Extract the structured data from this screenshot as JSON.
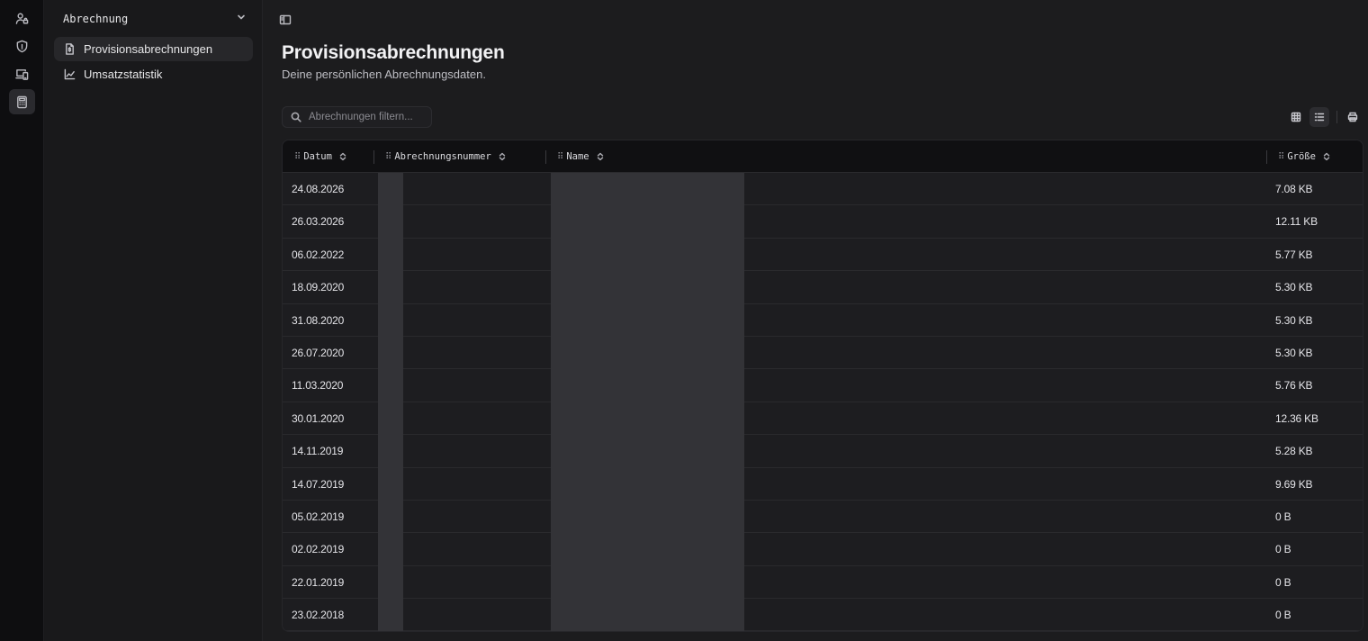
{
  "sidebar": {
    "section_title": "Abrechnung",
    "items": [
      {
        "label": "Provisionsabrechnungen",
        "icon": "file-dollar-icon",
        "active": true
      },
      {
        "label": "Umsatzstatistik",
        "icon": "line-chart-icon",
        "active": false
      }
    ]
  },
  "rail": {
    "icons": [
      "user-lock-icon",
      "shield-icon",
      "devices-icon",
      "calculator-icon"
    ],
    "active": "calculator-icon"
  },
  "page": {
    "title": "Provisionsabrechnungen",
    "subtitle": "Deine persönlichen Abrechnungsdaten."
  },
  "search": {
    "placeholder": "Abrechnungen filtern...",
    "value": ""
  },
  "toolbar": {
    "views": [
      "grid-view-icon",
      "list-view-icon"
    ],
    "active_view": "list-view-icon",
    "print_icon": "printer-icon"
  },
  "table": {
    "columns": [
      "Datum",
      "Abrechnungsnummer",
      "Name",
      "Größe"
    ],
    "rows": [
      {
        "date": "24.08.2026",
        "size": "7.08 KB"
      },
      {
        "date": "26.03.2026",
        "size": "12.11 KB"
      },
      {
        "date": "06.02.2022",
        "size": "5.77 KB"
      },
      {
        "date": "18.09.2020",
        "size": "5.30 KB"
      },
      {
        "date": "31.08.2020",
        "size": "5.30 KB"
      },
      {
        "date": "26.07.2020",
        "size": "5.30 KB"
      },
      {
        "date": "11.03.2020",
        "size": "5.76 KB"
      },
      {
        "date": "30.01.2020",
        "size": "12.36 KB"
      },
      {
        "date": "14.11.2019",
        "size": "5.28 KB"
      },
      {
        "date": "14.07.2019",
        "size": "9.69 KB"
      },
      {
        "date": "05.02.2019",
        "size": "0 B"
      },
      {
        "date": "02.02.2019",
        "size": "0 B"
      },
      {
        "date": "22.01.2019",
        "size": "0 B"
      },
      {
        "date": "23.02.2018",
        "size": "0 B"
      }
    ]
  },
  "colors": {
    "background": "#1c1c1e",
    "rail": "#0e0e10",
    "sidebar": "#19191b",
    "redaction": "#333337"
  }
}
